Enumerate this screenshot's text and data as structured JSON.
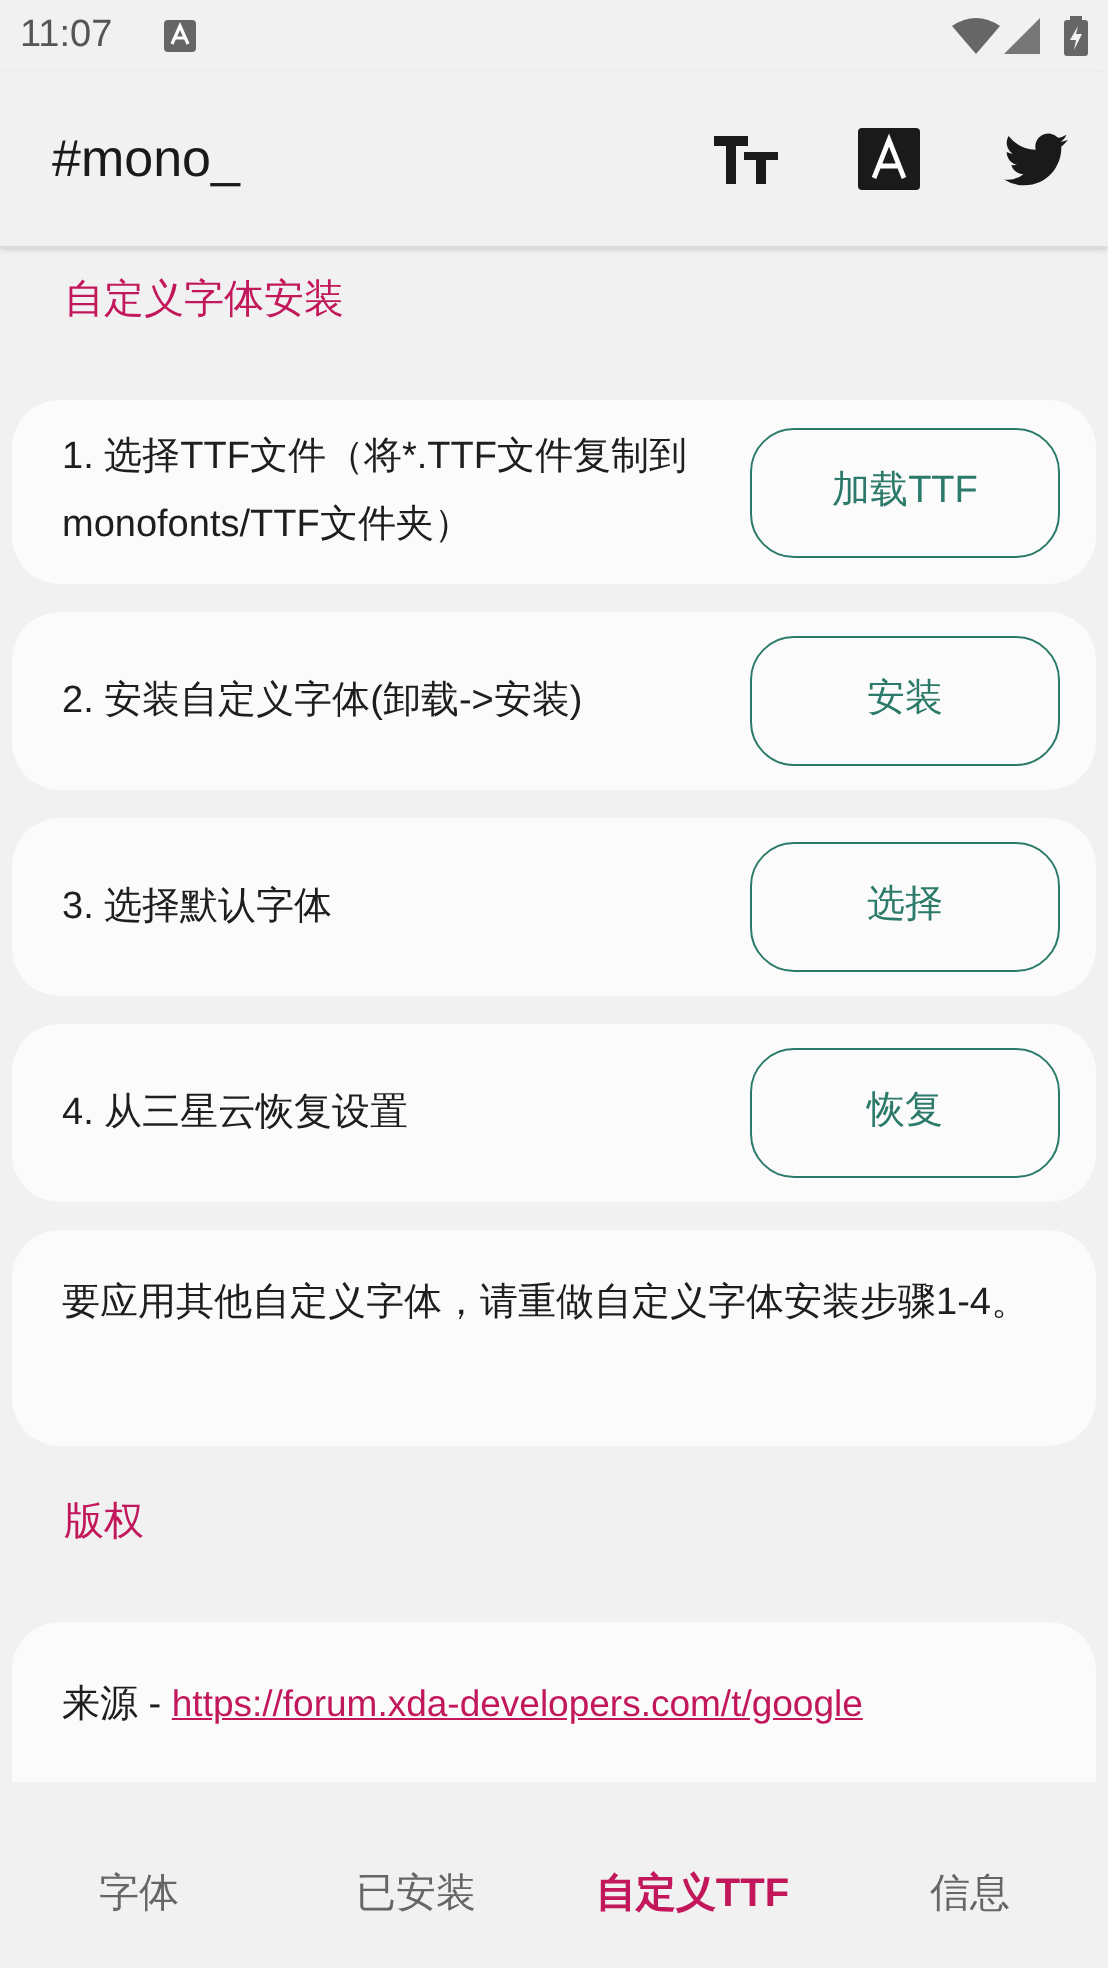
{
  "status_bar": {
    "time": "11:07"
  },
  "app_bar": {
    "title": "#mono_"
  },
  "sections": [
    {
      "title": "自定义字体安装",
      "cards": [
        {
          "kind": "step",
          "text": "1. 选择TTF文件（将*.TTF文件复制到monofonts/TTF文件夹）",
          "button": "加载TTF"
        },
        {
          "kind": "step",
          "text": "2. 安装自定义字体(卸载->安装)",
          "button": "安装"
        },
        {
          "kind": "step",
          "text": "3. 选择默认字体",
          "button": "选择"
        },
        {
          "kind": "step",
          "text": "4. 从三星云恢复设置",
          "button": "恢复"
        },
        {
          "kind": "note",
          "text": "要应用其他自定义字体，请重做自定义字体安装步骤1-4。"
        }
      ]
    },
    {
      "title": "版权",
      "cards": [
        {
          "kind": "source",
          "text": "来源 -",
          "link": "https://forum.xda-developers.com/t/google"
        }
      ]
    }
  ],
  "bottom_nav": [
    {
      "label": "字体",
      "selected": false
    },
    {
      "label": "已安装",
      "selected": false
    },
    {
      "label": "自定义TTF",
      "selected": true
    },
    {
      "label": "信息",
      "selected": false
    }
  ]
}
